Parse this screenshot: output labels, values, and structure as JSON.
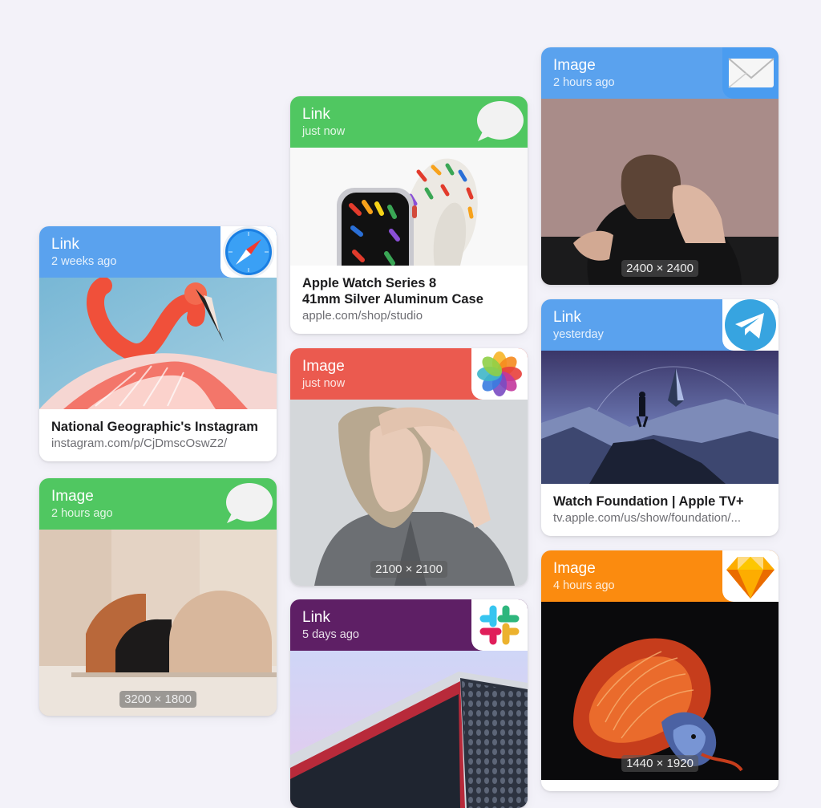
{
  "cards": [
    {
      "type": "Link",
      "time": "2 weeks ago",
      "app": "safari-icon",
      "color": "#5aa2ee",
      "title": "National Geographic's Instagram",
      "url": "instagram.com/p/CjDmscOswZ2/"
    },
    {
      "type": "Image",
      "time": "2 hours ago",
      "app": "messages-icon",
      "color": "#50c761",
      "dimensions": "3200 × 1800"
    },
    {
      "type": "Link",
      "time": "just now",
      "app": "messages-icon",
      "color": "#50c761",
      "title_line1": "Apple Watch Series 8",
      "title_line2": "41mm Silver Aluminum Case",
      "url": "apple.com/shop/studio"
    },
    {
      "type": "Image",
      "time": "just now",
      "app": "photos-icon",
      "color": "#eb5a4f",
      "dimensions": "2100 × 2100"
    },
    {
      "type": "Link",
      "time": "5 days ago",
      "app": "slack-icon",
      "color": "#5e1f65"
    },
    {
      "type": "Image",
      "time": "2 hours ago",
      "app": "mail-icon",
      "color": "#5aa2ee",
      "dimensions": "2400 × 2400"
    },
    {
      "type": "Link",
      "time": "yesterday",
      "app": "telegram-icon",
      "color": "#5aa2ee",
      "title": "Watch Foundation | Apple TV+",
      "url": "tv.apple.com/us/show/foundation/..."
    },
    {
      "type": "Image",
      "time": "4 hours ago",
      "app": "sketch-icon",
      "color": "#fb8b0f",
      "dimensions": "1440 × 1920"
    }
  ]
}
